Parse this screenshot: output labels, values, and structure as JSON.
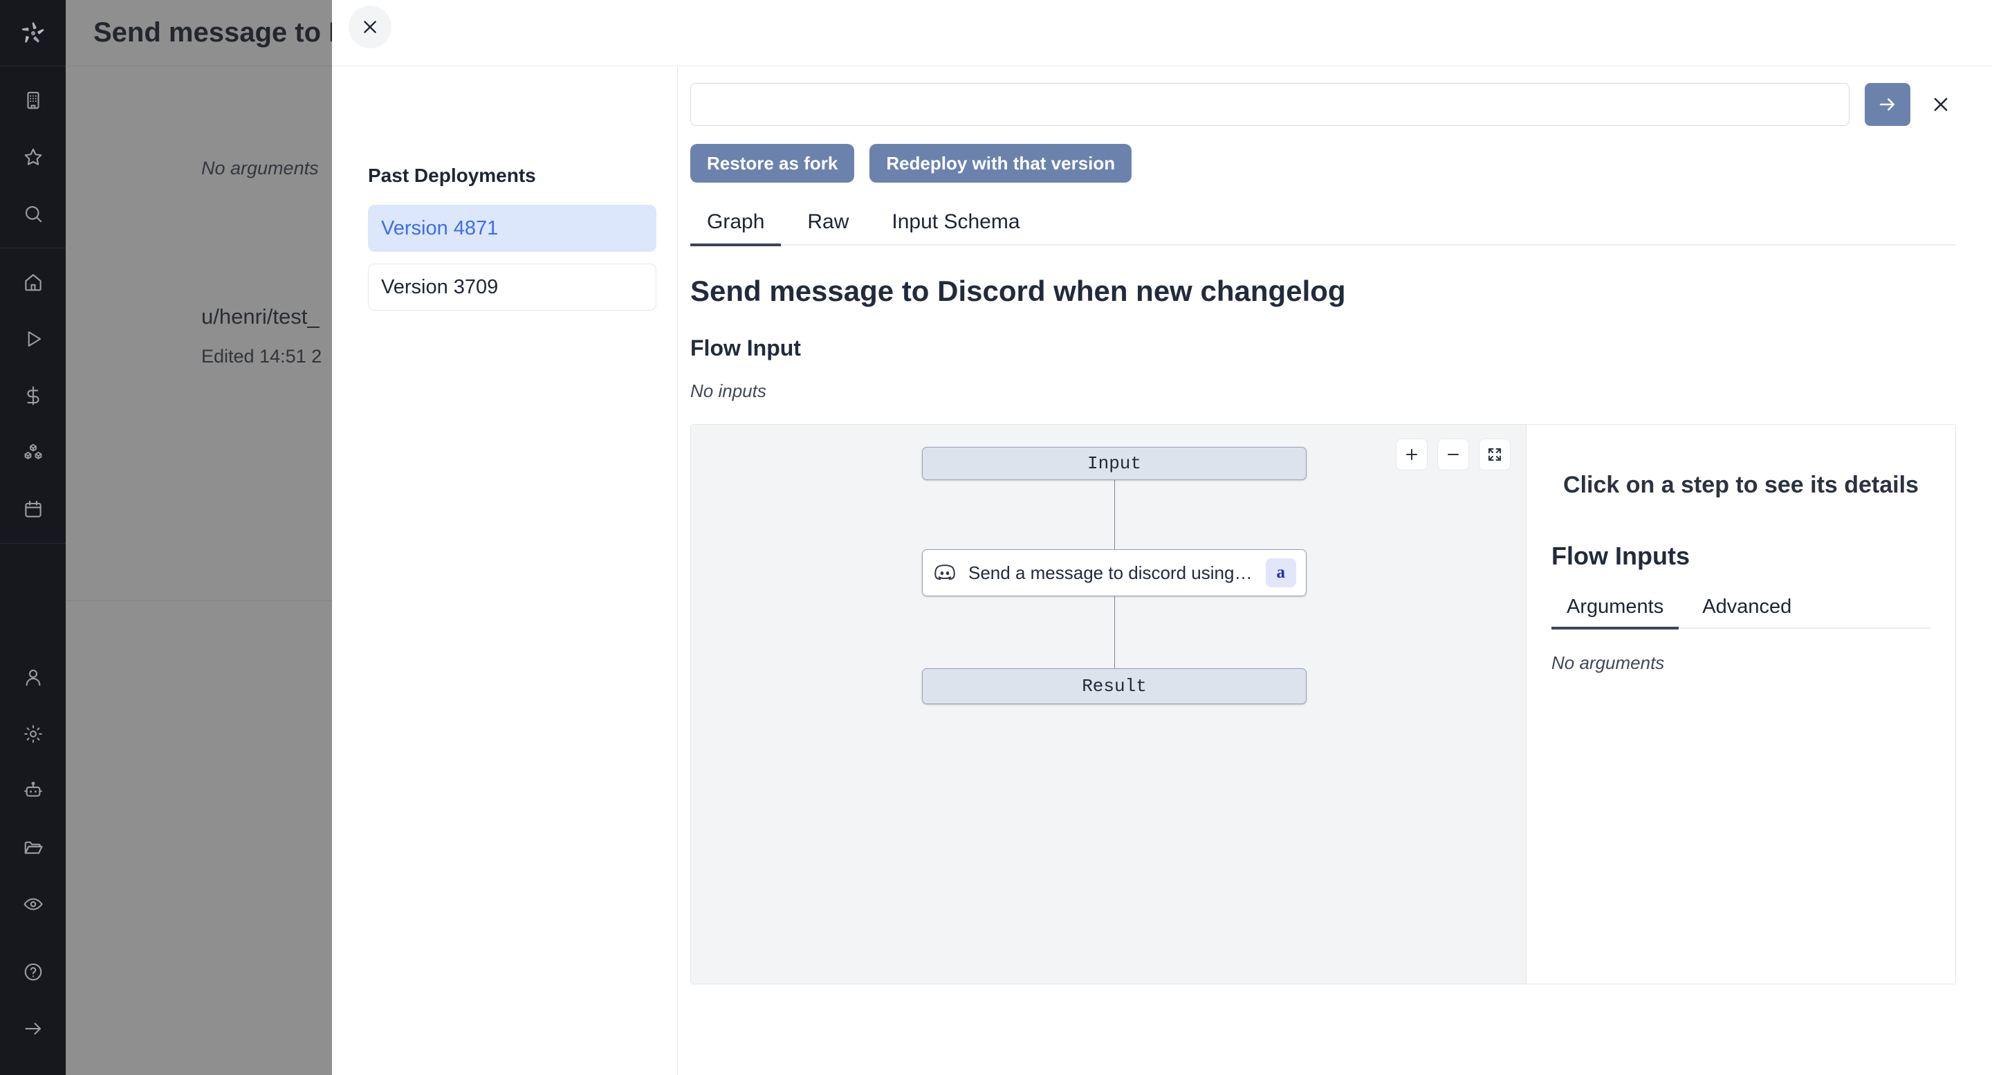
{
  "background_page": {
    "title": "Send message to Discord when new changelog",
    "no_arguments": "No arguments",
    "path": "u/henri/test_",
    "edited": "Edited 14:51 2"
  },
  "sidebar": {
    "logo_name": "windmill-logo",
    "groups": [
      {
        "items": [
          {
            "icon": "building-icon"
          },
          {
            "icon": "star-icon"
          },
          {
            "icon": "search-icon"
          }
        ]
      },
      {
        "items": [
          {
            "icon": "home-icon"
          },
          {
            "icon": "play-icon"
          },
          {
            "icon": "dollar-icon"
          },
          {
            "icon": "cubes-icon"
          },
          {
            "icon": "calendar-icon"
          }
        ]
      },
      {
        "items": [
          {
            "icon": "user-icon"
          },
          {
            "icon": "gear-icon"
          },
          {
            "icon": "robot-icon"
          },
          {
            "icon": "folder-icon"
          },
          {
            "icon": "eye-icon"
          }
        ]
      },
      {
        "items": [
          {
            "icon": "help-circle-icon"
          },
          {
            "icon": "arrow-right-icon"
          }
        ]
      }
    ]
  },
  "drawer": {
    "close_icon": "close-icon",
    "deployments": {
      "title": "Past Deployments",
      "items": [
        {
          "label": "Version 4871",
          "selected": true
        },
        {
          "label": "Version 3709",
          "selected": false
        }
      ]
    },
    "search": {
      "value": "",
      "placeholder": ""
    },
    "submit_icon": "arrow-right-icon",
    "dismiss_icon": "close-icon",
    "actions": {
      "restore": "Restore as fork",
      "redeploy": "Redeploy with that version"
    },
    "tabs": [
      {
        "label": "Graph",
        "active": true
      },
      {
        "label": "Raw",
        "active": false
      },
      {
        "label": "Input Schema",
        "active": false
      }
    ],
    "flow": {
      "title": "Send message to Discord when new changelog",
      "input_heading": "Flow Input",
      "no_inputs": "No inputs"
    },
    "graph": {
      "controls": [
        {
          "icon": "plus-icon"
        },
        {
          "icon": "minus-icon"
        },
        {
          "icon": "fullscreen-icon"
        }
      ],
      "nodes": [
        {
          "id": "input",
          "label": "Input",
          "type": "io"
        },
        {
          "id": "step-a",
          "label": "Send a message to discord using w…",
          "badge": "a",
          "type": "step",
          "icon": "discord-icon"
        },
        {
          "id": "result",
          "label": "Result",
          "type": "io"
        }
      ]
    },
    "details": {
      "hint": "Click on a step to see its details",
      "heading": "Flow Inputs",
      "tabs": [
        {
          "label": "Arguments",
          "active": true
        },
        {
          "label": "Advanced",
          "active": false
        }
      ],
      "empty": "No arguments"
    }
  },
  "colors": {
    "accent_blue": "#6b82ad",
    "selected_item_bg": "#dce7fb",
    "selected_item_text": "#3b6df0",
    "rail_bg": "#16181d",
    "node_io_bg": "#dde3ec",
    "badge_bg": "#e2e6fb",
    "badge_text": "#2b2fa8"
  }
}
